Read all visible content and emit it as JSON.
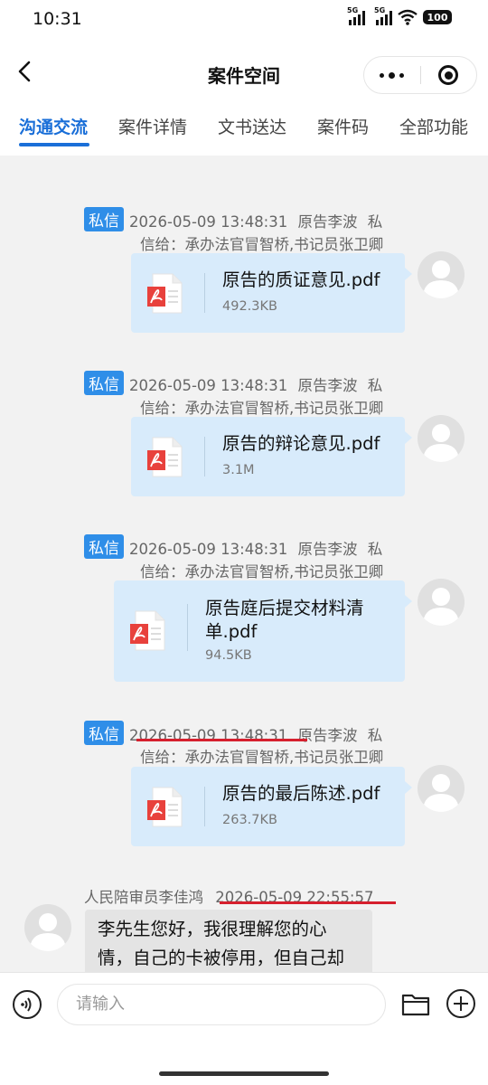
{
  "status_bar": {
    "time": "10:31",
    "sig1": "5G",
    "sig2": "5G",
    "battery": "100"
  },
  "nav": {
    "title": "案件空间"
  },
  "tabs": [
    "沟通交流",
    "案件详情",
    "文书送达",
    "案件码",
    "全部功能"
  ],
  "messages": [
    {
      "tag": "私信",
      "timestamp": "2026-05-09 13:48:31",
      "sender": "原告李波",
      "suffix": "私",
      "recipients": "信给：承办法官冒智桥,书记员张卫卿",
      "file_name": "原告的质证意见.pdf",
      "file_size": "492.3KB"
    },
    {
      "tag": "私信",
      "timestamp": "2026-05-09 13:48:31",
      "sender": "原告李波",
      "suffix": "私",
      "recipients": "信给：承办法官冒智桥,书记员张卫卿",
      "file_name": "原告的辩论意见.pdf",
      "file_size": "3.1M"
    },
    {
      "tag": "私信",
      "timestamp": "2026-05-09 13:48:31",
      "sender": "原告李波",
      "suffix": "私",
      "recipients": "信给：承办法官冒智桥,书记员张卫卿",
      "file_name_line1": "原告庭后提交材料清",
      "file_name_line2": "单.pdf",
      "file_size": "94.5KB"
    },
    {
      "tag": "私信",
      "timestamp": "2026-05-09 13:48:31",
      "sender": "原告李波",
      "suffix": "私",
      "recipients": "信给：承办法官冒智桥,书记员张卫卿",
      "file_name": "原告的最后陈述.pdf",
      "file_size": "263.7KB"
    }
  ],
  "incoming": {
    "sender": "人民陪审员李佳鸿",
    "timestamp": "2026-05-09 22:55:57",
    "line1": "李先生您好，我很理解您的心",
    "line2": "情，自己的卡被停用，但自己却"
  },
  "input": {
    "placeholder": "请输入"
  },
  "colors": {
    "accent": "#1a6fd8",
    "tag": "#2f8ee8",
    "bubble": "#d8ebfb",
    "highlight": "#d6202e"
  }
}
